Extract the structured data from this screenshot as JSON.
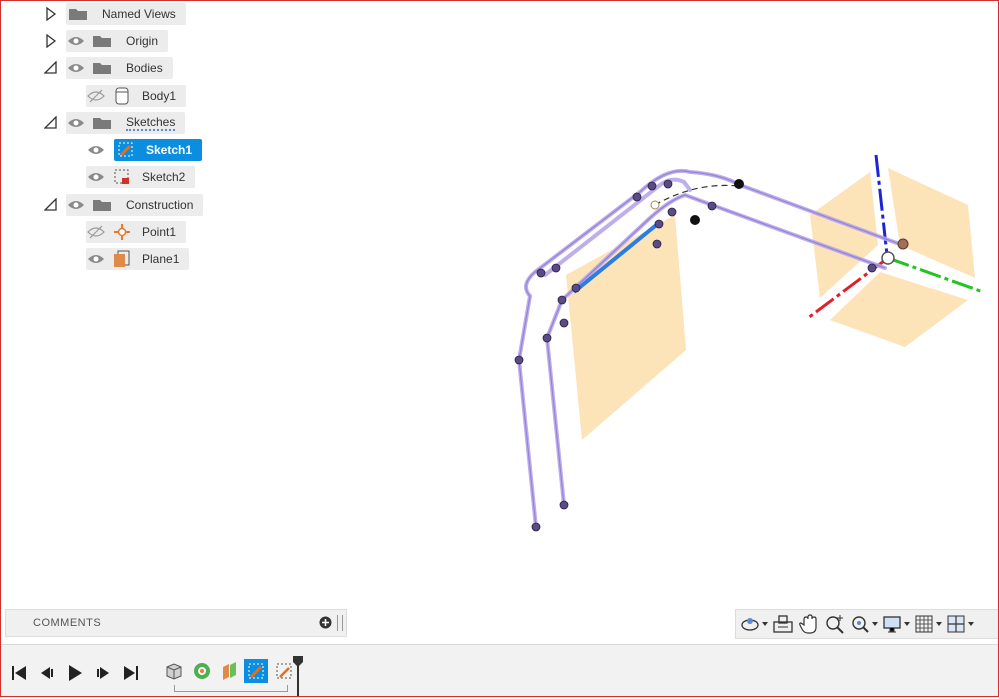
{
  "browser": {
    "nodes": [
      {
        "label": "Named Views",
        "expanded": false
      },
      {
        "label": "Origin",
        "expanded": false
      },
      {
        "label": "Bodies",
        "expanded": true
      },
      {
        "label": "Body1"
      },
      {
        "label": "Sketches",
        "expanded": true
      },
      {
        "label": "Sketch1",
        "selected": true
      },
      {
        "label": "Sketch2"
      },
      {
        "label": "Construction",
        "expanded": true
      },
      {
        "label": "Point1"
      },
      {
        "label": "Plane1"
      }
    ]
  },
  "comments": {
    "title": "COMMENTS"
  },
  "navbar": {
    "tools": [
      "orbit-icon",
      "look-at-icon",
      "pan-icon",
      "zoom-icon",
      "fit-icon",
      "display-settings-icon",
      "grid-settings-icon",
      "viewports-icon"
    ]
  },
  "timeline": {
    "controls": [
      "first-icon",
      "previous-icon",
      "play-icon",
      "next-icon",
      "last-icon"
    ],
    "features": [
      "body-feature-icon",
      "point-feature-icon",
      "plane-feature-icon",
      "sketch1-feature-icon",
      "sketch2-feature-icon"
    ]
  },
  "colors": {
    "selection": "#0c8ee0",
    "sketch_line": "#b7a6e8",
    "plane_fill": "#fde1b4",
    "axis_x": "#e0202a",
    "axis_y": "#22c41f",
    "axis_z": "#1b25d6"
  }
}
